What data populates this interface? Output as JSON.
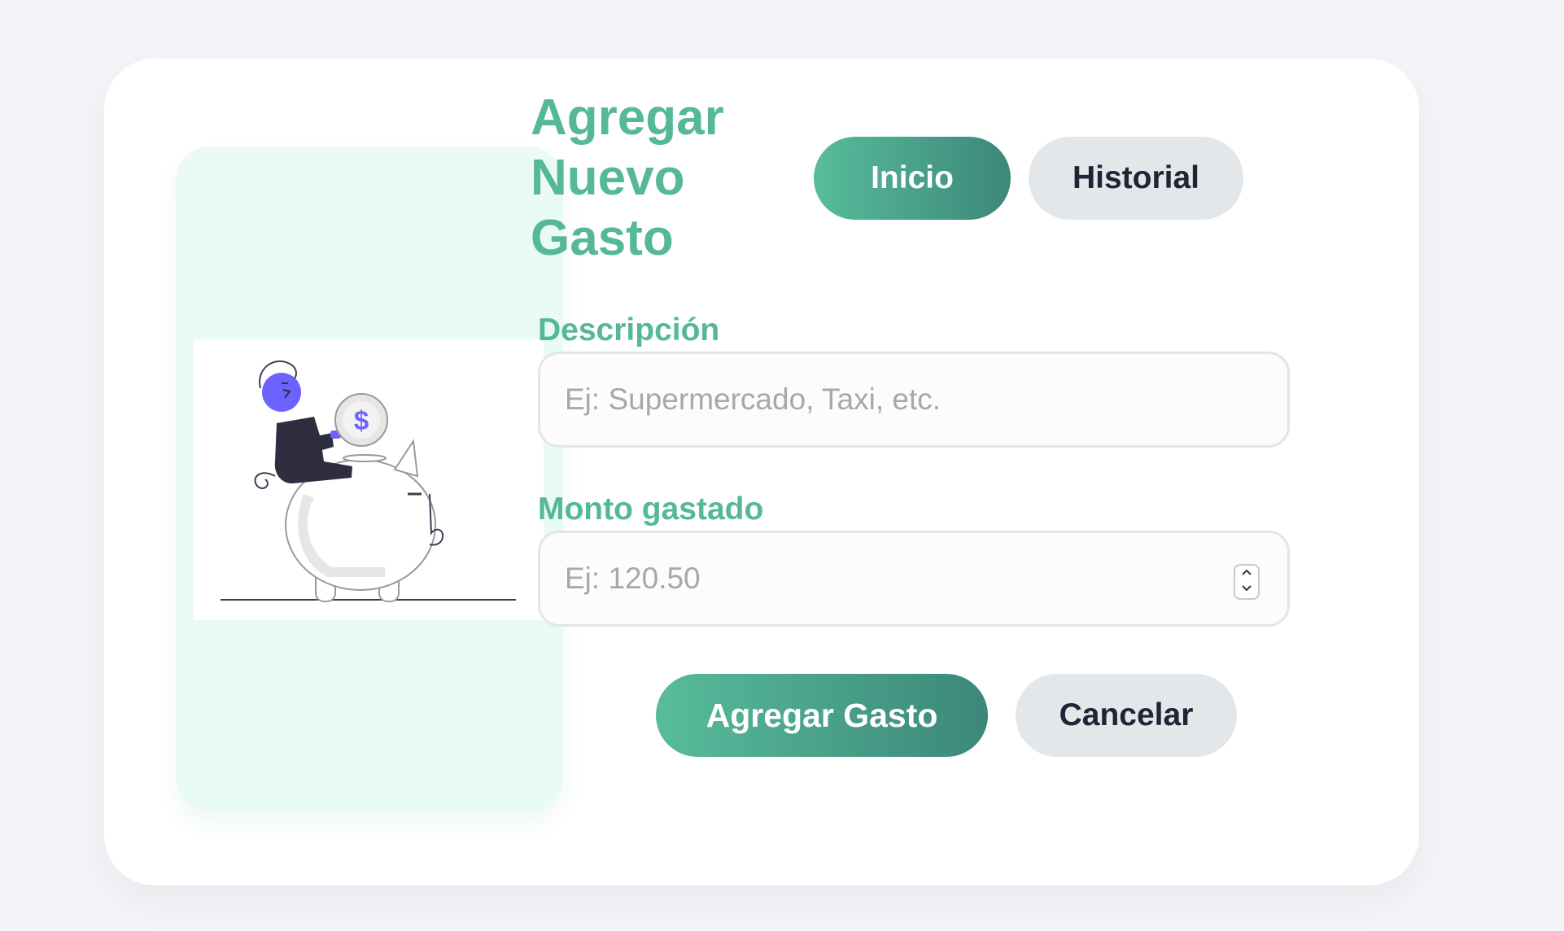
{
  "header": {
    "title": "Agregar Nuevo Gasto",
    "nav_inicio": "Inicio",
    "nav_historial": "Historial"
  },
  "form": {
    "descripcion_label": "Descripción",
    "descripcion_placeholder": "Ej: Supermercado, Taxi, etc.",
    "descripcion_value": "",
    "monto_label": "Monto gastado",
    "monto_placeholder": "Ej: 120.50",
    "monto_value": "",
    "submit_label": "Agregar Gasto",
    "cancel_label": "Cancelar"
  },
  "illustration": {
    "coin_symbol": "$",
    "icon": "piggy-bank-saving-illustration"
  },
  "colors": {
    "accent": "#55b896",
    "primary_gradient_start": "#58bc9b",
    "primary_gradient_end": "#3c8779",
    "secondary_button": "#e4e7ea",
    "panel_background": "#eafaf4",
    "illustration_purple": "#6c63ff",
    "text_dark": "#1e2535"
  }
}
